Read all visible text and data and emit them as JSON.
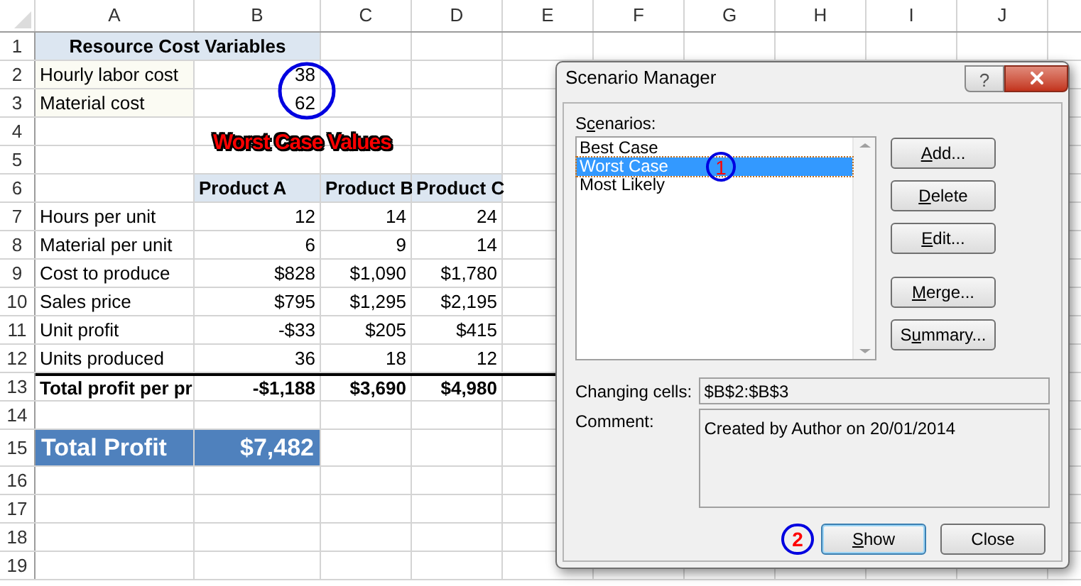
{
  "sheet": {
    "columns": [
      "A",
      "B",
      "C",
      "D",
      "E",
      "F",
      "G",
      "H",
      "I",
      "J"
    ],
    "rows": [
      {
        "number": "1",
        "kind": "title",
        "cells": [
          "Resource Cost Variables"
        ]
      },
      {
        "number": "2",
        "kind": "input",
        "cells": [
          "Hourly labor cost",
          "38"
        ]
      },
      {
        "number": "3",
        "kind": "input",
        "cells": [
          "Material cost",
          "62"
        ]
      },
      {
        "number": "4",
        "kind": "empty"
      },
      {
        "number": "5",
        "kind": "empty"
      },
      {
        "number": "6",
        "kind": "header",
        "cells": [
          "Product A",
          "Product B",
          "Product C"
        ]
      },
      {
        "number": "7",
        "kind": "data",
        "cells": [
          "Hours per unit",
          "12",
          "14",
          "24"
        ]
      },
      {
        "number": "8",
        "kind": "data",
        "cells": [
          "Material per unit",
          "6",
          "9",
          "14"
        ]
      },
      {
        "number": "9",
        "kind": "data",
        "cells": [
          "Cost to produce",
          "$828",
          "$1,090",
          "$1,780"
        ]
      },
      {
        "number": "10",
        "kind": "data",
        "cells": [
          "Sales price",
          "$795",
          "$1,295",
          "$2,195"
        ]
      },
      {
        "number": "11",
        "kind": "data",
        "cells": [
          "Unit profit",
          "-$33",
          "$205",
          "$415"
        ]
      },
      {
        "number": "12",
        "kind": "data",
        "cells": [
          "Units produced",
          "36",
          "18",
          "12"
        ]
      },
      {
        "number": "13",
        "kind": "total",
        "cells": [
          "Total profit per pr",
          "-$1,188",
          "$3,690",
          "$4,980"
        ]
      },
      {
        "number": "14",
        "kind": "empty"
      },
      {
        "number": "15",
        "kind": "summary",
        "cells": [
          "Total Profit",
          "$7,482"
        ]
      },
      {
        "number": "16",
        "kind": "empty"
      },
      {
        "number": "17",
        "kind": "empty"
      },
      {
        "number": "18",
        "kind": "empty"
      },
      {
        "number": "19",
        "kind": "empty"
      }
    ]
  },
  "callout": "Worst Case Values",
  "dialog": {
    "title": "Scenario Manager",
    "help_button": "?",
    "scenarios_label": [
      {
        "text": "S",
        "underline": false
      },
      {
        "text": "c",
        "underline": true
      },
      {
        "text": "enarios:",
        "underline": false
      }
    ],
    "scenarios": [
      {
        "name": "Best Case",
        "selected": false
      },
      {
        "name": "Worst Case",
        "selected": true,
        "marker": "1"
      },
      {
        "name": "Most Likely",
        "selected": false
      }
    ],
    "side_buttons": [
      {
        "label": [
          {
            "text": "A",
            "underline": true
          },
          {
            "text": "dd...",
            "underline": false
          }
        ]
      },
      {
        "label": [
          {
            "text": "D",
            "underline": true
          },
          {
            "text": "elete",
            "underline": false
          }
        ]
      },
      {
        "label": [
          {
            "text": "E",
            "underline": true
          },
          {
            "text": "dit...",
            "underline": false
          }
        ]
      },
      {
        "label": [
          {
            "text": "M",
            "underline": true
          },
          {
            "text": "erge...",
            "underline": false
          }
        ]
      },
      {
        "label": [
          {
            "text": "S",
            "underline": false
          },
          {
            "text": "u",
            "underline": true
          },
          {
            "text": "mmary...",
            "underline": false
          }
        ]
      }
    ],
    "changing_cells": {
      "label": "Changing cells:",
      "value": "$B$2:$B$3"
    },
    "comment": {
      "label": "Comment:",
      "value": "Created by Author on 20/01/2014"
    },
    "footer_buttons": [
      {
        "label": [
          {
            "text": "S",
            "underline": true
          },
          {
            "text": "how",
            "underline": false
          }
        ],
        "marker": "2",
        "default": true
      },
      {
        "label": [
          {
            "text": "Close",
            "underline": false
          }
        ],
        "default": false
      }
    ]
  }
}
